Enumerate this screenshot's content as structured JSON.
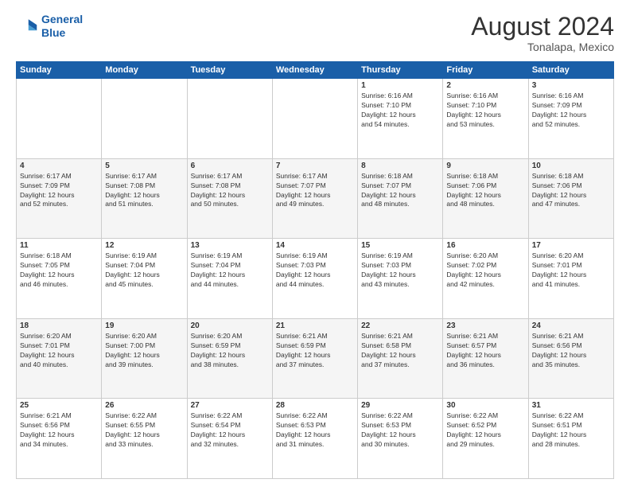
{
  "header": {
    "logo_line1": "General",
    "logo_line2": "Blue",
    "month_year": "August 2024",
    "location": "Tonalapa, Mexico"
  },
  "days_of_week": [
    "Sunday",
    "Monday",
    "Tuesday",
    "Wednesday",
    "Thursday",
    "Friday",
    "Saturday"
  ],
  "weeks": [
    [
      {
        "day": "",
        "content": ""
      },
      {
        "day": "",
        "content": ""
      },
      {
        "day": "",
        "content": ""
      },
      {
        "day": "",
        "content": ""
      },
      {
        "day": "1",
        "content": "Sunrise: 6:16 AM\nSunset: 7:10 PM\nDaylight: 12 hours\nand 54 minutes."
      },
      {
        "day": "2",
        "content": "Sunrise: 6:16 AM\nSunset: 7:10 PM\nDaylight: 12 hours\nand 53 minutes."
      },
      {
        "day": "3",
        "content": "Sunrise: 6:16 AM\nSunset: 7:09 PM\nDaylight: 12 hours\nand 52 minutes."
      }
    ],
    [
      {
        "day": "4",
        "content": "Sunrise: 6:17 AM\nSunset: 7:09 PM\nDaylight: 12 hours\nand 52 minutes."
      },
      {
        "day": "5",
        "content": "Sunrise: 6:17 AM\nSunset: 7:08 PM\nDaylight: 12 hours\nand 51 minutes."
      },
      {
        "day": "6",
        "content": "Sunrise: 6:17 AM\nSunset: 7:08 PM\nDaylight: 12 hours\nand 50 minutes."
      },
      {
        "day": "7",
        "content": "Sunrise: 6:17 AM\nSunset: 7:07 PM\nDaylight: 12 hours\nand 49 minutes."
      },
      {
        "day": "8",
        "content": "Sunrise: 6:18 AM\nSunset: 7:07 PM\nDaylight: 12 hours\nand 48 minutes."
      },
      {
        "day": "9",
        "content": "Sunrise: 6:18 AM\nSunset: 7:06 PM\nDaylight: 12 hours\nand 48 minutes."
      },
      {
        "day": "10",
        "content": "Sunrise: 6:18 AM\nSunset: 7:06 PM\nDaylight: 12 hours\nand 47 minutes."
      }
    ],
    [
      {
        "day": "11",
        "content": "Sunrise: 6:18 AM\nSunset: 7:05 PM\nDaylight: 12 hours\nand 46 minutes."
      },
      {
        "day": "12",
        "content": "Sunrise: 6:19 AM\nSunset: 7:04 PM\nDaylight: 12 hours\nand 45 minutes."
      },
      {
        "day": "13",
        "content": "Sunrise: 6:19 AM\nSunset: 7:04 PM\nDaylight: 12 hours\nand 44 minutes."
      },
      {
        "day": "14",
        "content": "Sunrise: 6:19 AM\nSunset: 7:03 PM\nDaylight: 12 hours\nand 44 minutes."
      },
      {
        "day": "15",
        "content": "Sunrise: 6:19 AM\nSunset: 7:03 PM\nDaylight: 12 hours\nand 43 minutes."
      },
      {
        "day": "16",
        "content": "Sunrise: 6:20 AM\nSunset: 7:02 PM\nDaylight: 12 hours\nand 42 minutes."
      },
      {
        "day": "17",
        "content": "Sunrise: 6:20 AM\nSunset: 7:01 PM\nDaylight: 12 hours\nand 41 minutes."
      }
    ],
    [
      {
        "day": "18",
        "content": "Sunrise: 6:20 AM\nSunset: 7:01 PM\nDaylight: 12 hours\nand 40 minutes."
      },
      {
        "day": "19",
        "content": "Sunrise: 6:20 AM\nSunset: 7:00 PM\nDaylight: 12 hours\nand 39 minutes."
      },
      {
        "day": "20",
        "content": "Sunrise: 6:20 AM\nSunset: 6:59 PM\nDaylight: 12 hours\nand 38 minutes."
      },
      {
        "day": "21",
        "content": "Sunrise: 6:21 AM\nSunset: 6:59 PM\nDaylight: 12 hours\nand 37 minutes."
      },
      {
        "day": "22",
        "content": "Sunrise: 6:21 AM\nSunset: 6:58 PM\nDaylight: 12 hours\nand 37 minutes."
      },
      {
        "day": "23",
        "content": "Sunrise: 6:21 AM\nSunset: 6:57 PM\nDaylight: 12 hours\nand 36 minutes."
      },
      {
        "day": "24",
        "content": "Sunrise: 6:21 AM\nSunset: 6:56 PM\nDaylight: 12 hours\nand 35 minutes."
      }
    ],
    [
      {
        "day": "25",
        "content": "Sunrise: 6:21 AM\nSunset: 6:56 PM\nDaylight: 12 hours\nand 34 minutes."
      },
      {
        "day": "26",
        "content": "Sunrise: 6:22 AM\nSunset: 6:55 PM\nDaylight: 12 hours\nand 33 minutes."
      },
      {
        "day": "27",
        "content": "Sunrise: 6:22 AM\nSunset: 6:54 PM\nDaylight: 12 hours\nand 32 minutes."
      },
      {
        "day": "28",
        "content": "Sunrise: 6:22 AM\nSunset: 6:53 PM\nDaylight: 12 hours\nand 31 minutes."
      },
      {
        "day": "29",
        "content": "Sunrise: 6:22 AM\nSunset: 6:53 PM\nDaylight: 12 hours\nand 30 minutes."
      },
      {
        "day": "30",
        "content": "Sunrise: 6:22 AM\nSunset: 6:52 PM\nDaylight: 12 hours\nand 29 minutes."
      },
      {
        "day": "31",
        "content": "Sunrise: 6:22 AM\nSunset: 6:51 PM\nDaylight: 12 hours\nand 28 minutes."
      }
    ]
  ]
}
